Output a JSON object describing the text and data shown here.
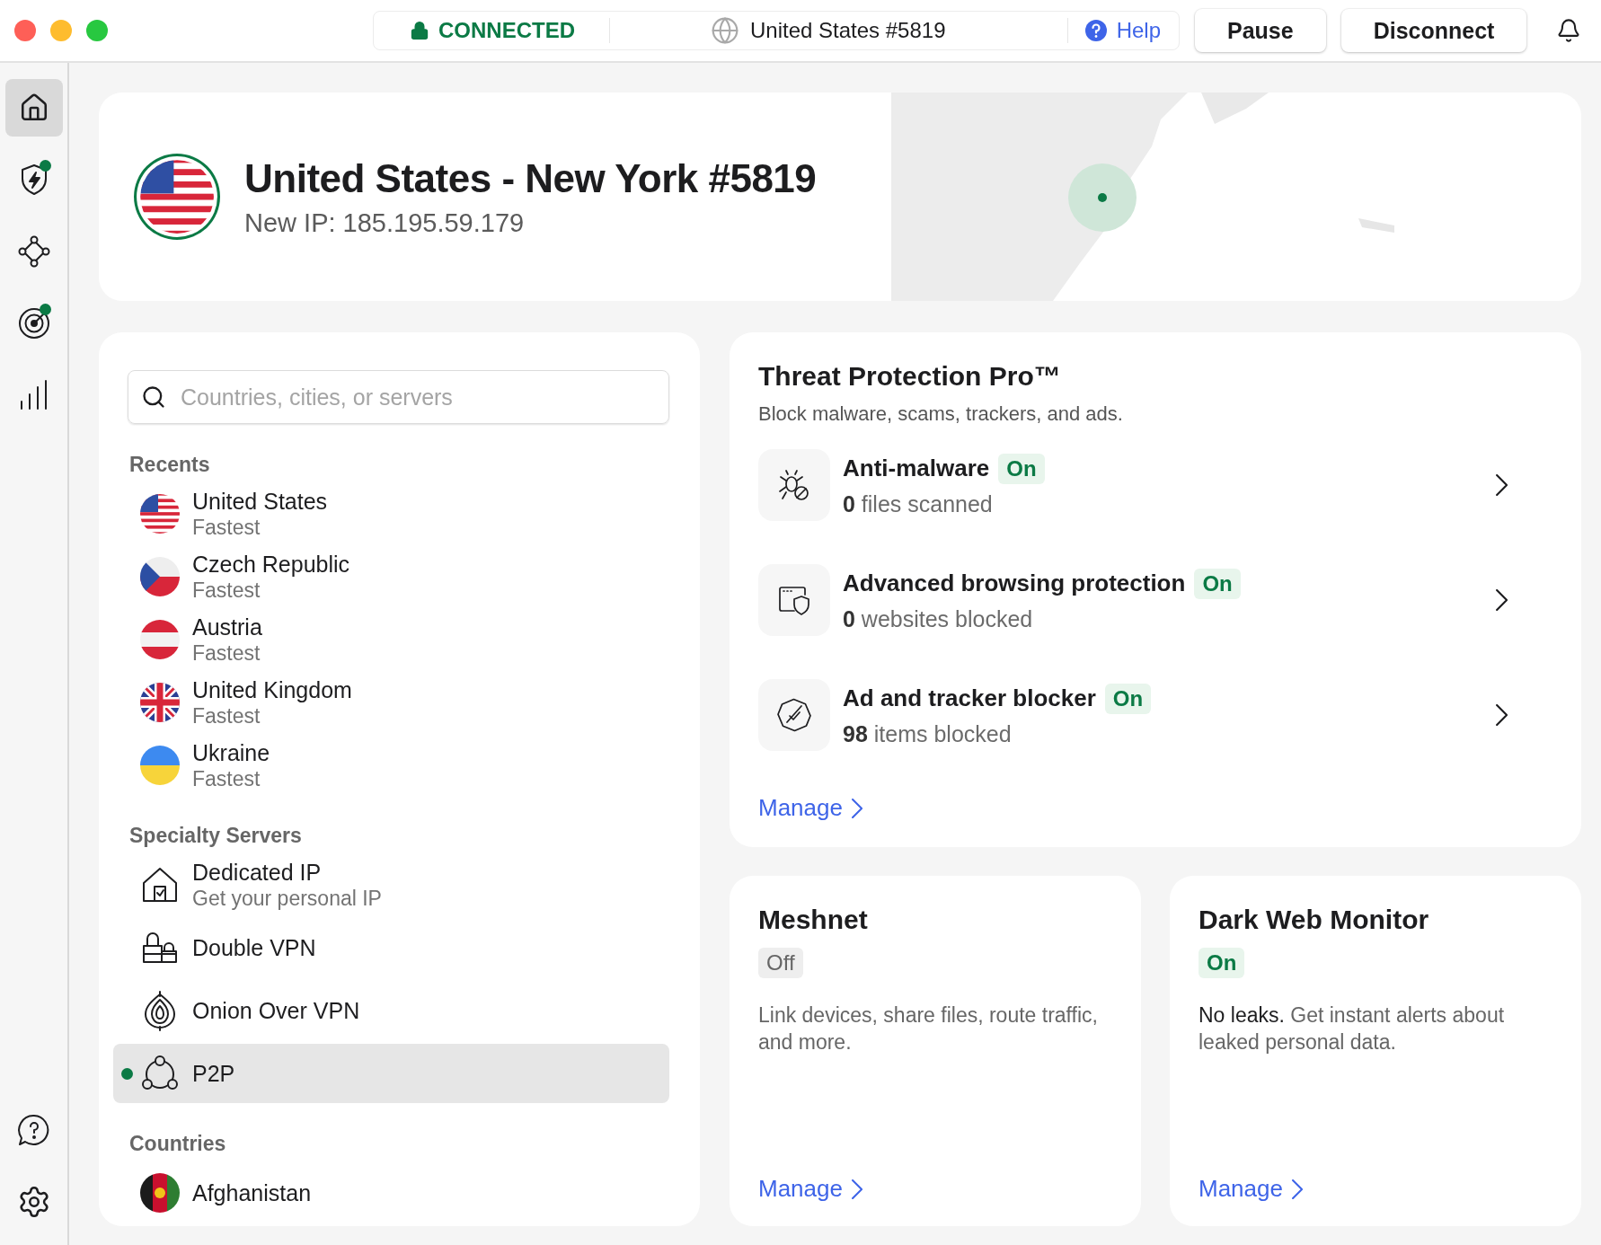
{
  "titlebar": {
    "status": "CONNECTED",
    "server": "United States #5819",
    "help": "Help",
    "buttons": [
      "Pause",
      "Disconnect"
    ]
  },
  "nav": [
    {
      "kind": "home",
      "selected": true,
      "badge": false
    },
    {
      "kind": "shield",
      "selected": false,
      "badge": true
    },
    {
      "kind": "mesh",
      "selected": false,
      "badge": false
    },
    {
      "kind": "radar",
      "selected": false,
      "badge": true
    },
    {
      "kind": "stats",
      "selected": false,
      "badge": false
    }
  ],
  "nav_bottom": [
    {
      "kind": "help",
      "selected": false
    },
    {
      "kind": "settings",
      "selected": false
    }
  ],
  "connection": {
    "title": "United States - New York #5819",
    "ip": "New IP: 185.195.59.179",
    "kind": "us"
  },
  "servers": {
    "search": {
      "placeholder": "Countries, cities, or servers"
    },
    "sections": [
      {
        "heading": "Recents",
        "items": [
          {
            "kind": "us",
            "name": "United States",
            "detail": "Fastest",
            "selected": false
          },
          {
            "kind": "cz",
            "name": "Czech Republic",
            "detail": "Fastest",
            "selected": false
          },
          {
            "kind": "at",
            "name": "Austria",
            "detail": "Fastest",
            "selected": false
          },
          {
            "kind": "gb",
            "name": "United Kingdom",
            "detail": "Fastest",
            "selected": false
          },
          {
            "kind": "ua",
            "name": "Ukraine",
            "detail": "Fastest",
            "selected": false
          }
        ]
      },
      {
        "heading": "Specialty Servers",
        "items": [
          {
            "kind": "dedicated",
            "name": "Dedicated IP",
            "detail": "Get your personal IP",
            "selected": false
          },
          {
            "kind": "double",
            "name": "Double VPN",
            "selected": false
          },
          {
            "kind": "onion",
            "name": "Onion Over VPN",
            "selected": false
          },
          {
            "kind": "p2p",
            "name": "P2P",
            "selected": true
          }
        ]
      },
      {
        "heading": "Countries",
        "items": [
          {
            "kind": "af",
            "name": "Afghanistan",
            "selected": false
          }
        ]
      }
    ]
  },
  "threat": {
    "title": "Threat Protection Pro™",
    "subtitle": "Block malware, scams, trackers, and ads.",
    "features": [
      {
        "kind": "bug",
        "name": "Anti-malware",
        "status": "On",
        "on": true,
        "count": "**0** files scanned"
      },
      {
        "kind": "browser",
        "name": "Advanced browsing protection",
        "status": "On",
        "on": true,
        "count": "**0** websites blocked"
      },
      {
        "kind": "blocker",
        "name": "Ad and tracker blocker",
        "status": "On",
        "on": true,
        "count": "**98** items blocked"
      }
    ],
    "manage": "Manage"
  },
  "cards": [
    {
      "title": "Meshnet",
      "status": "Off",
      "on": false,
      "description": "Link devices, share files, route traffic, and more.",
      "manage": "Manage"
    },
    {
      "title": "Dark Web Monitor",
      "status": "On",
      "on": true,
      "description": "**No leaks.** Get instant alerts about leaked personal data.",
      "manage": "Manage"
    }
  ]
}
